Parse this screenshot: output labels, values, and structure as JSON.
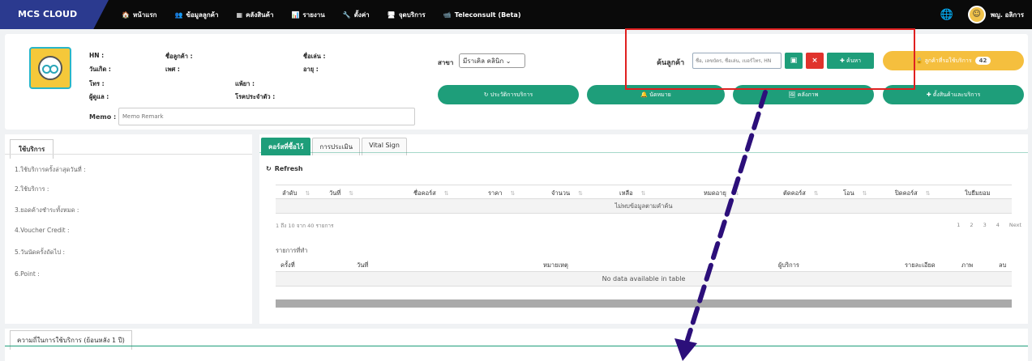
{
  "brand": "MCS CLOUD",
  "nav": [
    {
      "icon": "🏠",
      "label": "หน้าแรก"
    },
    {
      "icon": "👥",
      "label": "ข้อมูลลูกค้า"
    },
    {
      "icon": "▦",
      "label": "คลังสินค้า"
    },
    {
      "icon": "📊",
      "label": "รายงาน"
    },
    {
      "icon": "🔧",
      "label": "ตั้งค่า"
    },
    {
      "icon": "🖥",
      "label": "จุดบริการ"
    },
    {
      "icon": "📹",
      "label": "Teleconsult (Beta)"
    }
  ],
  "user": {
    "name": "พญ. อลิการ"
  },
  "patient": {
    "hn": "HN :",
    "name": "ชื่อลูกค้า :",
    "nickname": "ชื่อเล่น :",
    "birthdate": "วันเกิด :",
    "gender": "เพศ :",
    "age": "อายุ :",
    "phone": "โทร :",
    "allergy": "แพ้ยา :",
    "referrer": "ผู้ดูแล :",
    "disease": "โรคประจำตัว :",
    "memo_label": "Memo :",
    "memo_placeholder": "Memo Remark"
  },
  "branch": {
    "label": "สาขา",
    "value": "มีราเคิล คลินิก"
  },
  "search": {
    "label": "ค้นลูกค้า",
    "placeholder": "ชื่อ, เลขบัตร, ชื่อเล่น, เบอร์โทร, HN",
    "button": "✚ ค้นหา"
  },
  "queue": {
    "label": "🔒 ลูกค้าที่รอใช้บริการ",
    "count": "42"
  },
  "actions": [
    "↻ ประวัติการบริการ",
    "🔔 นัดหมาย",
    "🖼 คลังภาพ",
    "✚ ตั้งสินค้าและบริการ"
  ],
  "left": {
    "tab": "ใช้บริการ",
    "items": [
      "1.ใช้บริการครั้งล่าสุดวันที่ :",
      "2.ใช้บริการ :",
      "3.ยอดค้างชำระทั้งหมด :",
      "4.Voucher Credit :",
      "5.วันนัดครั้งถัดไป :",
      "6.Point :"
    ]
  },
  "tabs": [
    "คอร์สที่ซื้อไว้",
    "การประเมิน",
    "Vital Sign"
  ],
  "refresh": "Refresh",
  "table1": {
    "headers": [
      "ลำดับ",
      "วันที่",
      "ชื่อคอร์ส",
      "ราคา",
      "จำนวน",
      "เหลือ",
      "หมดอายุ",
      "ตัดคอร์ส",
      "โอน",
      "ปิดคอร์ส",
      "ใบยืมยอม"
    ],
    "empty": "ไม่พบข้อมูลตามคำค้น",
    "info": "1 ถึง 10 จาก 40 รายการ",
    "pages": [
      "1",
      "2",
      "3",
      "4",
      "Next"
    ]
  },
  "table2": {
    "title": "รายการที่ทำ",
    "headers": [
      "ครั้งที่",
      "วันที่",
      "หมายเหตุ",
      "ผู้บริการ",
      "รายละเอียด",
      "ภาพ",
      "ลบ"
    ],
    "empty": "No data available in table"
  },
  "bottom_tab": "ความถี่ในการใช้บริการ (ย้อนหลัง 1 ปี)"
}
